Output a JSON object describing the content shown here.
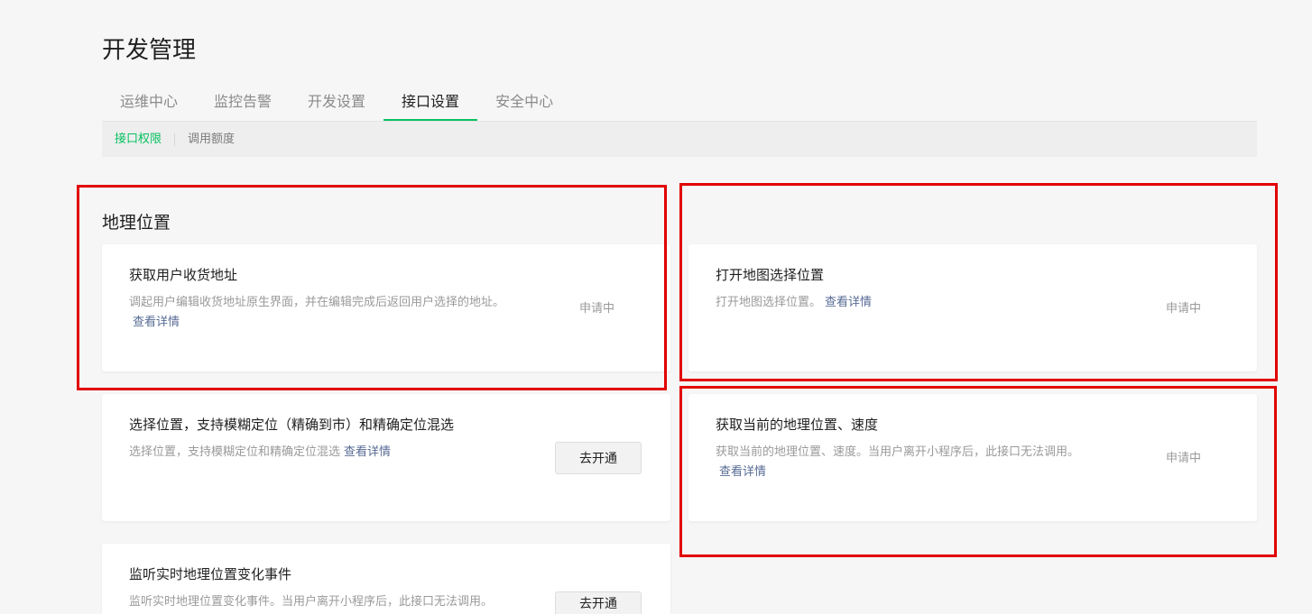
{
  "header": {
    "title": "开发管理"
  },
  "tabs": [
    {
      "label": "运维中心"
    },
    {
      "label": "监控告警"
    },
    {
      "label": "开发设置"
    },
    {
      "label": "接口设置"
    },
    {
      "label": "安全中心"
    }
  ],
  "subnav": [
    {
      "label": "接口权限"
    },
    {
      "label": "调用额度"
    }
  ],
  "section": {
    "title": "地理位置"
  },
  "cards": [
    {
      "title": "获取用户收货地址",
      "desc": "调起用户编辑收货地址原生界面，并在编辑完成后返回用户选择的地址。",
      "link": "查看详情",
      "status": "申请中"
    },
    {
      "title": "打开地图选择位置",
      "desc": "打开地图选择位置。",
      "link": "查看详情",
      "status": "申请中"
    },
    {
      "title": "选择位置，支持模糊定位（精确到市）和精确定位混选",
      "desc": "选择位置，支持模糊定位和精确定位混选",
      "link": "查看详情",
      "button": "去开通"
    },
    {
      "title": "获取当前的地理位置、速度",
      "desc": "获取当前的地理位置、速度。当用户离开小程序后，此接口无法调用。",
      "link": "查看详情",
      "status": "申请中"
    },
    {
      "title": "监听实时地理位置变化事件",
      "desc": "监听实时地理位置变化事件。当用户离开小程序后，此接口无法调用。",
      "button": "去开通"
    }
  ],
  "colors": {
    "accent": "#07c160",
    "link": "#576b95",
    "highlight": "#e10000"
  }
}
